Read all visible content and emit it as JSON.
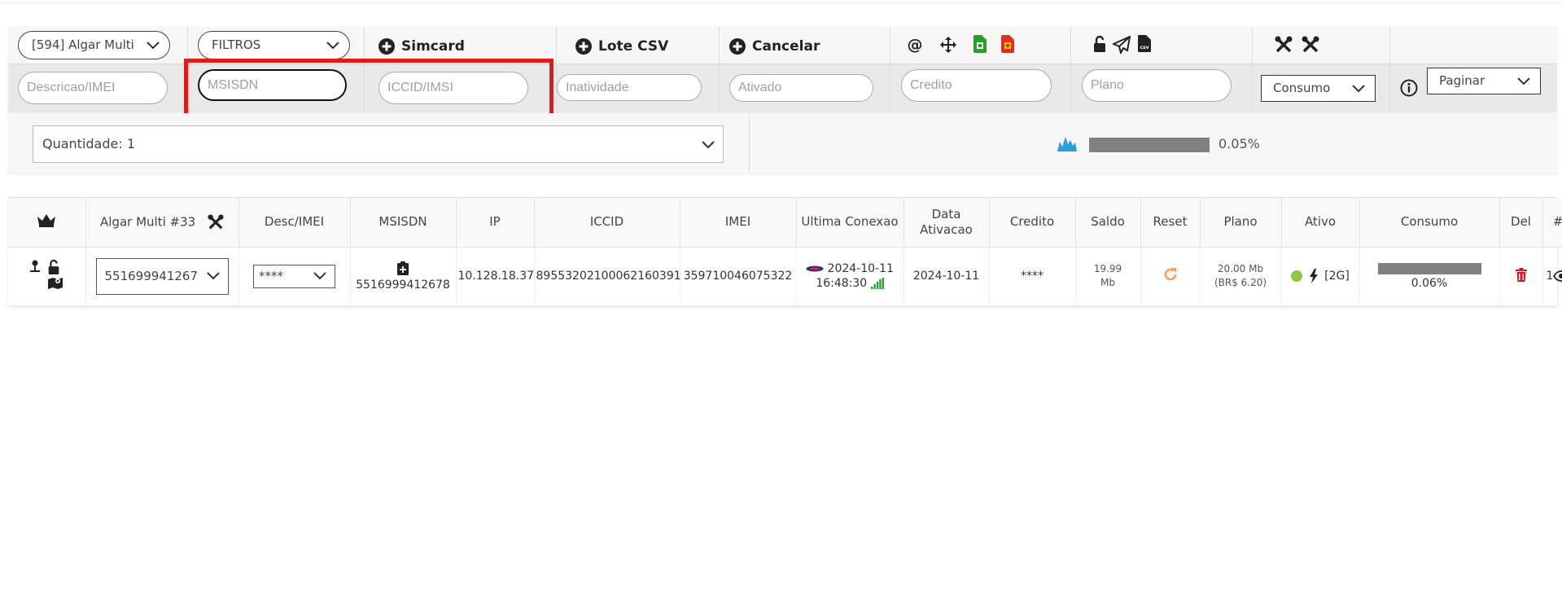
{
  "toolbar": {
    "account_select": "[594] Algar Multi",
    "filters_select": "FILTROS",
    "add_simcard_label": "Simcard",
    "lote_csv_label": "Lote CSV",
    "cancelar_label": "Cancelar",
    "at_symbol": "@",
    "filters": {
      "descricao_placeholder": "Descricao/IMEI",
      "msisdn_placeholder": "MSISDN",
      "iccid_placeholder": "ICCID/IMSI",
      "inatividade_placeholder": "Inatividade",
      "ativado_placeholder": "Ativado",
      "credito_placeholder": "Credito",
      "plano_placeholder": "Plano",
      "consumo_select": "Consumo",
      "paginar_select": "Paginar"
    }
  },
  "summary": {
    "quantidade": "Quantidade: 1",
    "consumption_percent": "0.05%",
    "consumption_fraction": 0.0005
  },
  "table": {
    "headers": {
      "account": "Algar Multi #33",
      "desc": "Desc/IMEI",
      "msisdn": "MSISDN",
      "ip": "IP",
      "iccid": "ICCID",
      "imei": "IMEI",
      "ultima_conexao": "Ultima Conexao",
      "data_ativacao": "Data Ativacao",
      "credito": "Credito",
      "saldo": "Saldo",
      "reset": "Reset",
      "plano": "Plano",
      "ativo": "Ativo",
      "consumo": "Consumo",
      "del": "Del",
      "hash": "#"
    },
    "rows": [
      {
        "number_select": "551699941267",
        "desc_select": "****",
        "msisdn": "5516999412678",
        "ip": "10.128.18.37",
        "iccid": "8955320210006 2160391",
        "iccid_full": "89553202100062160391",
        "imei": "359710046075322",
        "ultima_conexao_date": "2024-10-11",
        "ultima_conexao_time": "16:48:30",
        "data_ativacao": "2024-10-11",
        "credito": "****",
        "saldo_value": "19.99",
        "saldo_unit": "Mb",
        "plano_mb": "20.00 Mb",
        "plano_price": "(BR$ 6.20)",
        "ativo_network": "[2G]",
        "consumo_percent": "0.06%",
        "consumo_fraction": 0.0006,
        "index": "1"
      }
    ]
  },
  "colors": {
    "highlight": "#e01b1b",
    "active_dot": "#8dc63f",
    "reset_icon": "#f0a75a",
    "delete_icon": "#d9141f",
    "bar_fill": "#808080",
    "sim_green": "#2a9d2a",
    "sim_red": "#e0301e",
    "signal_green": "#2ea02e",
    "chart_blue": "#2a9fd6"
  }
}
